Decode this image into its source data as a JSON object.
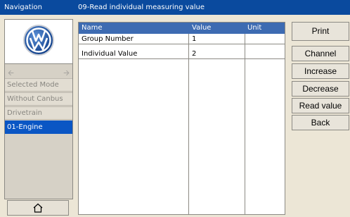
{
  "titlebar": {
    "navigation": "Navigation",
    "page": "09-Read individual measuring value"
  },
  "sidebar": {
    "logo": "vw-logo-icon",
    "back_icon": "arrow-left-icon",
    "forward_icon": "arrow-right-icon",
    "items": [
      {
        "label": "Selected Mode"
      },
      {
        "label": "Without Canbus"
      },
      {
        "label": "Drivetrain"
      },
      {
        "label": "01-Engine",
        "active": true
      }
    ],
    "home_icon": "home-icon"
  },
  "table": {
    "headers": [
      "Name",
      "Value",
      "Unit"
    ],
    "rows": [
      {
        "name": "Group Number",
        "value": "1",
        "unit": ""
      },
      {
        "name": "Individual Value",
        "value": "2",
        "unit": ""
      }
    ]
  },
  "buttons": {
    "print": "Print",
    "channel": "Channel",
    "increase": "Increase",
    "decrease": "Decrease",
    "read_value": "Read value",
    "back": "Back"
  },
  "colors": {
    "titlebar": "#0a4a9e",
    "header": "#3d6bb2",
    "active_item": "#0a56c4",
    "background": "#ece6d6"
  }
}
